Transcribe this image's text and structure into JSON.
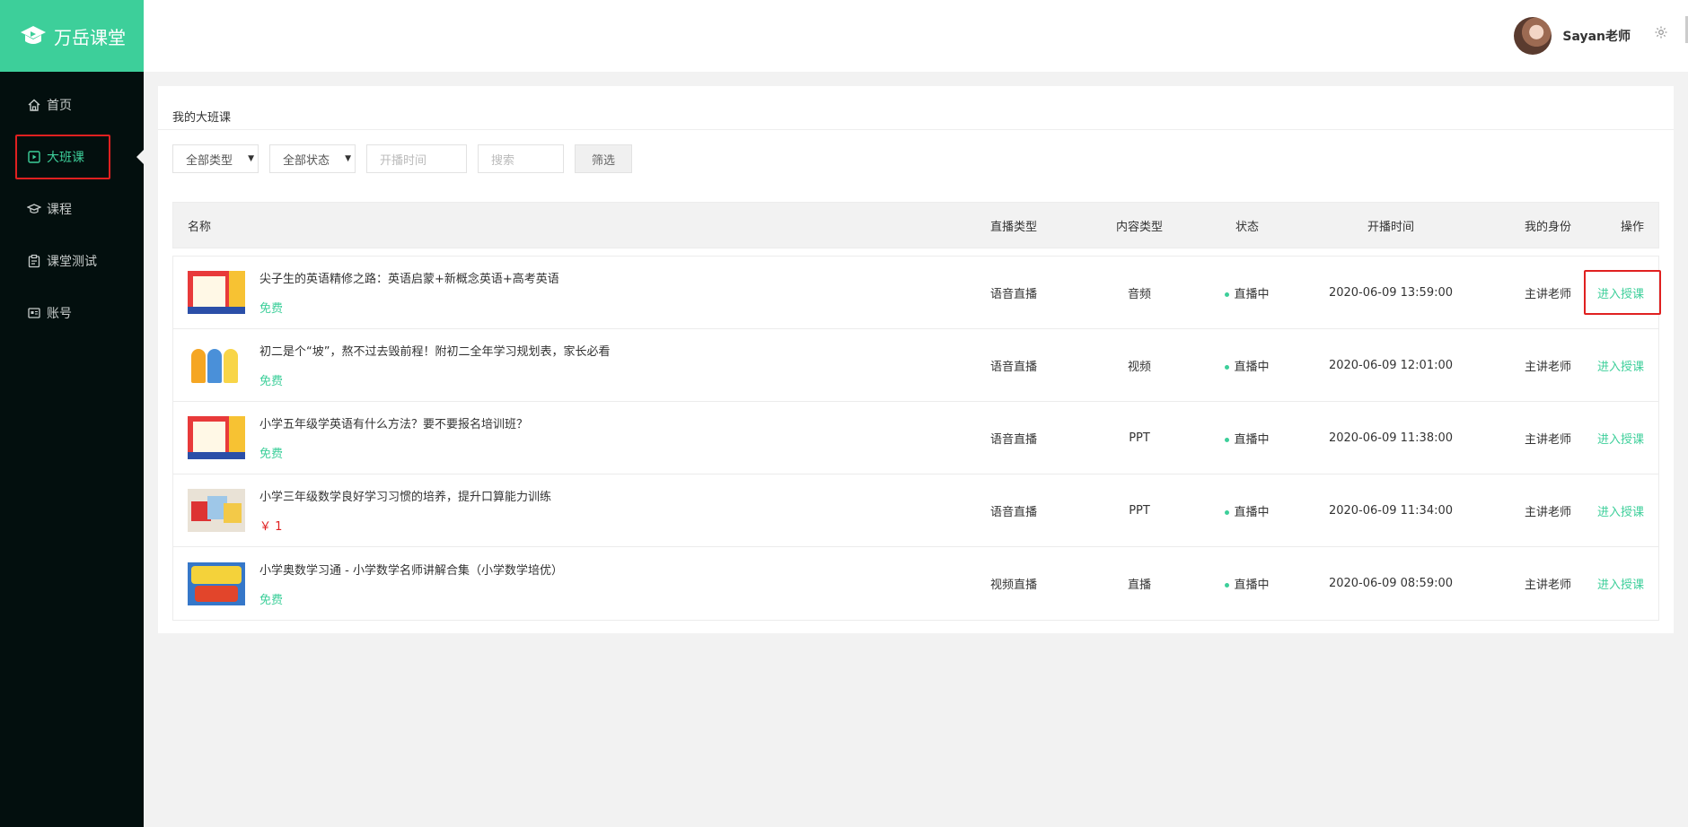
{
  "app": {
    "logo_text": "万岳课堂",
    "brand_color": "#3dcf9a",
    "highlight_color": "#e02020"
  },
  "sidebar": {
    "items": [
      {
        "label": "首页",
        "icon": "home-icon"
      },
      {
        "label": "大班课",
        "icon": "play-square-icon",
        "active": true
      },
      {
        "label": "课程",
        "icon": "graduation-cap-icon"
      },
      {
        "label": "课堂测试",
        "icon": "clipboard-icon"
      },
      {
        "label": "账号",
        "icon": "id-card-icon"
      }
    ]
  },
  "header": {
    "username": "Sayan老师",
    "settings_icon": "gear-icon"
  },
  "main": {
    "title": "我的大班课",
    "filters": {
      "type_select": "全部类型",
      "status_select": "全部状态",
      "date_placeholder": "开播时间",
      "search_placeholder": "搜索",
      "filter_button": "筛选"
    },
    "table": {
      "headers": {
        "name": "名称",
        "live_type": "直播类型",
        "content_type": "内容类型",
        "status": "状态",
        "start_time": "开播时间",
        "role": "我的身份",
        "action": "操作"
      },
      "rows": [
        {
          "title": "尖子生的英语精修之路：英语启蒙+新概念英语+高考英语",
          "price": "免费",
          "live_type": "语音直播",
          "content_type": "音频",
          "status": "直播中",
          "start_time": "2020-06-09 13:59:00",
          "role": "主讲老师",
          "action": "进入授课"
        },
        {
          "title": "初二是个“坡”，熬不过去毁前程！附初二全年学习规划表，家长必看",
          "price": "免费",
          "live_type": "语音直播",
          "content_type": "视频",
          "status": "直播中",
          "start_time": "2020-06-09 12:01:00",
          "role": "主讲老师",
          "action": "进入授课"
        },
        {
          "title": "小学五年级学英语有什么方法？要不要报名培训班？",
          "price": "免费",
          "live_type": "语音直播",
          "content_type": "PPT",
          "status": "直播中",
          "start_time": "2020-06-09 11:38:00",
          "role": "主讲老师",
          "action": "进入授课"
        },
        {
          "title": "小学三年级数学良好学习习惯的培养，提升口算能力训练",
          "price": "￥ 1",
          "live_type": "语音直播",
          "content_type": "PPT",
          "status": "直播中",
          "start_time": "2020-06-09 11:34:00",
          "role": "主讲老师",
          "action": "进入授课"
        },
        {
          "title": "小学奥数学习通 - 小学数学名师讲解合集（小学数学培优）",
          "price": "免费",
          "live_type": "视频直播",
          "content_type": "直播",
          "status": "直播中",
          "start_time": "2020-06-09 08:59:00",
          "role": "主讲老师",
          "action": "进入授课"
        }
      ]
    }
  }
}
